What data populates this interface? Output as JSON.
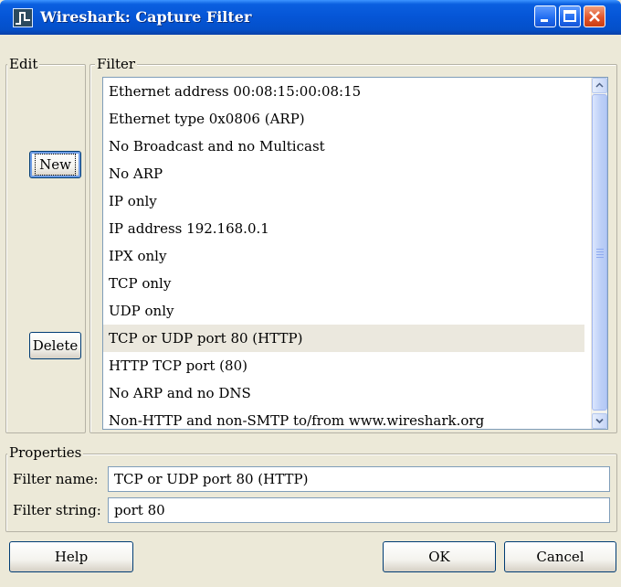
{
  "window": {
    "title": "Wireshark: Capture Filter"
  },
  "edit": {
    "label": "Edit",
    "new_label": "New",
    "delete_label": "Delete"
  },
  "filter": {
    "label": "Filter",
    "selected_index": 9,
    "items": [
      {
        "label": "Ethernet address 00:08:15:00:08:15"
      },
      {
        "label": "Ethernet type 0x0806 (ARP)"
      },
      {
        "label": "No Broadcast and no Multicast"
      },
      {
        "label": "No ARP"
      },
      {
        "label": "IP only"
      },
      {
        "label": "IP address 192.168.0.1"
      },
      {
        "label": "IPX only"
      },
      {
        "label": "TCP only"
      },
      {
        "label": "UDP only"
      },
      {
        "label": "TCP or UDP port 80 (HTTP)"
      },
      {
        "label": "HTTP TCP port (80)"
      },
      {
        "label": "No ARP and no DNS"
      },
      {
        "label": "Non-HTTP and non-SMTP to/from www.wireshark.org"
      }
    ]
  },
  "properties": {
    "label": "Properties",
    "filter_name_label": "Filter name:",
    "filter_name_value": "TCP or UDP port 80 (HTTP)",
    "filter_string_label": "Filter string:",
    "filter_string_value": "port 80"
  },
  "buttons": {
    "help": "Help",
    "ok": "OK",
    "cancel": "Cancel"
  }
}
